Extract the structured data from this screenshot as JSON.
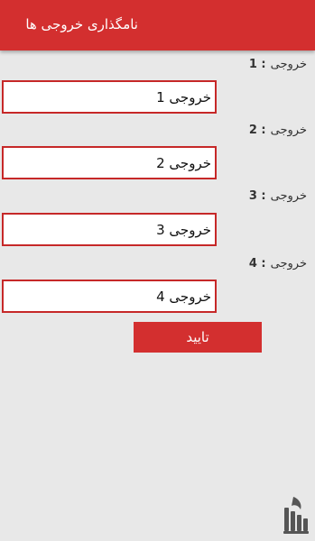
{
  "header": {
    "title": "نامگذاری خروجی ها",
    "color": "#d32f2f"
  },
  "outputs": [
    {
      "label_text": "خروجی",
      "label_num": "1 :",
      "value": "خروجی 1"
    },
    {
      "label_text": "خروجی",
      "label_num": "2 :",
      "value": "خروجی 2"
    },
    {
      "label_text": "خروجی",
      "label_num": "3 :",
      "value": "خروجی 3"
    },
    {
      "label_text": "خروجی",
      "label_num": "4 :",
      "value": "خروجی 4"
    }
  ],
  "confirm": {
    "label": "تایید"
  },
  "logo": {
    "icon": "logo-icon"
  }
}
